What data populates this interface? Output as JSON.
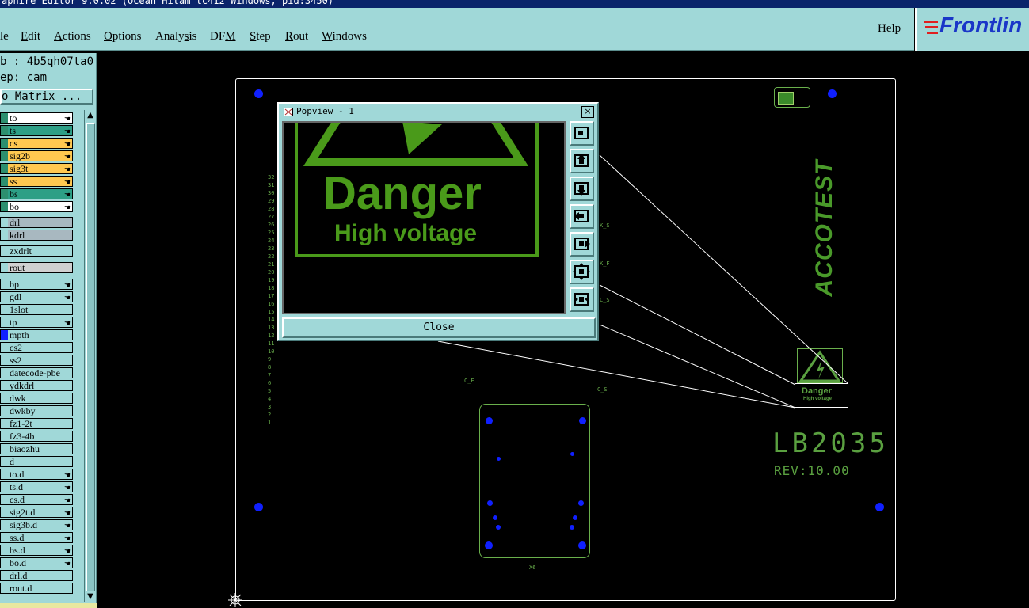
{
  "window": {
    "title": "aphire Editor 9.0.02 (Ocean Hitam tc412  Windows, pid:3450)"
  },
  "menubar": {
    "items": [
      {
        "pre": "",
        "u": "",
        "rest": "le"
      },
      {
        "pre": "",
        "u": "E",
        "rest": "dit"
      },
      {
        "pre": "",
        "u": "A",
        "rest": "ctions"
      },
      {
        "pre": "",
        "u": "O",
        "rest": "ptions"
      },
      {
        "pre": "Analy",
        "u": "s",
        "rest": "is"
      },
      {
        "pre": "DF",
        "u": "M",
        "rest": ""
      },
      {
        "pre": "",
        "u": "S",
        "rest": "tep"
      },
      {
        "pre": "",
        "u": "R",
        "rest": "out"
      },
      {
        "pre": "",
        "u": "W",
        "rest": "indows"
      }
    ],
    "help": "Help",
    "logo": "Frontlin"
  },
  "leftpanel": {
    "job_line": "b : 4b5qh07ta0",
    "step_line": "ep: cam",
    "matrix_button": "o Matrix ...",
    "layers": [
      {
        "name": "to",
        "bg": "#ffffff",
        "sw": "#2d8f6f",
        "hand": true
      },
      {
        "name": "ts",
        "bg": "#2d9f86",
        "sw": "#2d8f6f",
        "hand": true
      },
      {
        "name": "cs",
        "bg": "#ffc850",
        "sw": "#2d8f6f",
        "hand": true
      },
      {
        "name": "sig2b",
        "bg": "#ffc850",
        "sw": "#2d8f6f",
        "hand": true
      },
      {
        "name": "sig3t",
        "bg": "#ffc850",
        "sw": "#2d8f6f",
        "hand": true
      },
      {
        "name": "ss",
        "bg": "#ffc850",
        "sw": "#2d8f6f",
        "hand": true
      },
      {
        "name": "bs",
        "bg": "#2d9f86",
        "sw": "#2d8f6f",
        "hand": true
      },
      {
        "name": "bo",
        "bg": "#ffffff",
        "sw": "#2d8f6f",
        "hand": true
      },
      {
        "name": "drl",
        "bg": "#a8b8c0",
        "sw": "#a0d8d8",
        "hand": false
      },
      {
        "name": "kdrl",
        "bg": "#a8b8c0",
        "sw": "#a0d8d8",
        "hand": false
      },
      {
        "name": "zxdrlt",
        "bg": "#a0d8d8",
        "sw": "#a0d8d8",
        "hand": false
      },
      {
        "name": "rout",
        "bg": "#d0d0d0",
        "sw": "#a0d8d8",
        "hand": false
      },
      {
        "name": "bp",
        "bg": "#a0d8d8",
        "sw": "#a0d8d8",
        "hand": true
      },
      {
        "name": "gdl",
        "bg": "#a0d8d8",
        "sw": "#a0d8d8",
        "hand": true
      },
      {
        "name": "1slot",
        "bg": "#a0d8d8",
        "sw": "#a0d8d8",
        "hand": false
      },
      {
        "name": "tp",
        "bg": "#a0d8d8",
        "sw": "#a0d8d8",
        "hand": true
      },
      {
        "name": "mpth",
        "bg": "#a0d8d8",
        "sw": "#1020ff",
        "hand": false
      },
      {
        "name": "cs2",
        "bg": "#a0d8d8",
        "sw": "#a0d8d8",
        "hand": false
      },
      {
        "name": "ss2",
        "bg": "#a0d8d8",
        "sw": "#a0d8d8",
        "hand": false
      },
      {
        "name": "datecode-pbe",
        "bg": "#a0d8d8",
        "sw": "#a0d8d8",
        "hand": false
      },
      {
        "name": "ydkdrl",
        "bg": "#a0d8d8",
        "sw": "#a0d8d8",
        "hand": false
      },
      {
        "name": "dwk",
        "bg": "#a0d8d8",
        "sw": "#a0d8d8",
        "hand": false
      },
      {
        "name": "dwkby",
        "bg": "#a0d8d8",
        "sw": "#a0d8d8",
        "hand": false
      },
      {
        "name": "fz1-2t",
        "bg": "#a0d8d8",
        "sw": "#a0d8d8",
        "hand": false
      },
      {
        "name": "fz3-4b",
        "bg": "#a0d8d8",
        "sw": "#a0d8d8",
        "hand": false
      },
      {
        "name": "biaozhu",
        "bg": "#a0d8d8",
        "sw": "#a0d8d8",
        "hand": false
      },
      {
        "name": "d",
        "bg": "#a0d8d8",
        "sw": "#a0d8d8",
        "hand": false
      },
      {
        "name": "to.d",
        "bg": "#a0d8d8",
        "sw": "#a0d8d8",
        "hand": true
      },
      {
        "name": "ts.d",
        "bg": "#a0d8d8",
        "sw": "#a0d8d8",
        "hand": true
      },
      {
        "name": "cs.d",
        "bg": "#a0d8d8",
        "sw": "#a0d8d8",
        "hand": true
      },
      {
        "name": "sig2t.d",
        "bg": "#a0d8d8",
        "sw": "#a0d8d8",
        "hand": true
      },
      {
        "name": "sig3b.d",
        "bg": "#a0d8d8",
        "sw": "#a0d8d8",
        "hand": true
      },
      {
        "name": "ss.d",
        "bg": "#a0d8d8",
        "sw": "#a0d8d8",
        "hand": true
      },
      {
        "name": "bs.d",
        "bg": "#a0d8d8",
        "sw": "#a0d8d8",
        "hand": true
      },
      {
        "name": "bo.d",
        "bg": "#a0d8d8",
        "sw": "#a0d8d8",
        "hand": true
      },
      {
        "name": "drl.d",
        "bg": "#a0d8d8",
        "sw": "#a0d8d8",
        "hand": false
      },
      {
        "name": "rout.d",
        "bg": "#a0d8d8",
        "sw": "#a0d8d8",
        "hand": false
      }
    ]
  },
  "popview": {
    "title": "Popview - 1",
    "close_x": "×",
    "danger": "Danger",
    "high_voltage": "High voltage",
    "close_button": "Close"
  },
  "board": {
    "part_number": "LB2035",
    "revision": "REV:10.00",
    "brand": "ACCOTEST",
    "mini_danger": "Danger",
    "mini_hv": "High voltage",
    "label_ks": "K_S",
    "label_kf": "K_F",
    "label_cs": "C_S",
    "label_cf": "C_F",
    "label_cs2": "C_S",
    "label_x6": "X6",
    "ruler": [
      "32",
      "31",
      "30",
      "29",
      "28",
      "27",
      "26",
      "25",
      "24",
      "23",
      "22",
      "21",
      "20",
      "19",
      "18",
      "17",
      "16",
      "15",
      "14",
      "13",
      "12",
      "11",
      "10",
      "9",
      "8",
      "7",
      "6",
      "5",
      "4",
      "3",
      "2",
      "1"
    ]
  },
  "colors": {
    "panel": "#a0d8d8",
    "pad_blue": "#1020ff",
    "silk_green": "#5aa040"
  }
}
